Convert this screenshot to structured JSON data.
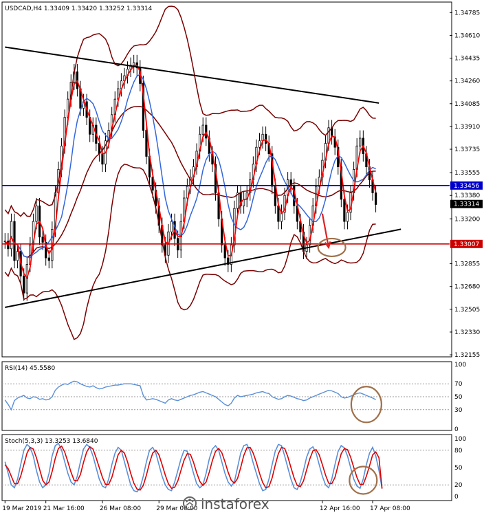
{
  "chart_data": [
    {
      "type": "line",
      "title": "USDCAD,H4  1.33409 1.33420 1.33252 1.33314",
      "symbol": "USDCAD,H4",
      "ohlc": {
        "open": 1.33409,
        "high": 1.3342,
        "low": 1.33252,
        "close": 1.33314
      },
      "ylim": [
        1.3215,
        1.3485
      ],
      "y_ticks": [
        "1.34785",
        "1.34610",
        "1.34435",
        "1.34260",
        "1.34085",
        "1.33910",
        "1.33735",
        "1.33555",
        "1.33380",
        "1.33200",
        "1.32855",
        "1.32680",
        "1.32505",
        "1.32330",
        "1.32155"
      ],
      "x_ticks": [
        "19 Mar 2019",
        "21 Mar 16:00",
        "26 Mar 08:00",
        "29 Mar 00:00",
        "12 Apr 16:00",
        "17 Apr 08:00"
      ],
      "bar_count": 130,
      "horizontal_levels": [
        {
          "value": 1.33456,
          "label": "1.33456",
          "color": "#0000cc"
        },
        {
          "value": 1.33007,
          "label": "1.33007",
          "color": "#cc0000"
        }
      ],
      "current_price": {
        "value": 1.33314,
        "label": "1.33314"
      },
      "price_series": [
        1.3303,
        1.3297,
        1.3318,
        1.3288,
        1.3295,
        1.3276,
        1.3263,
        1.3285,
        1.33,
        1.3318,
        1.333,
        1.3306,
        1.3302,
        1.329,
        1.3288,
        1.3312,
        1.334,
        1.3358,
        1.3376,
        1.3398,
        1.3412,
        1.3425,
        1.3433,
        1.342,
        1.3405,
        1.341,
        1.3398,
        1.3385,
        1.3392,
        1.3378,
        1.337,
        1.3362,
        1.338,
        1.3388,
        1.34,
        1.3412,
        1.342,
        1.3426,
        1.343,
        1.3435,
        1.3438,
        1.344,
        1.3436,
        1.3424,
        1.3388,
        1.3368,
        1.3352,
        1.3342,
        1.333,
        1.3315,
        1.33,
        1.3292,
        1.331,
        1.3318,
        1.3305,
        1.3296,
        1.3318,
        1.3336,
        1.3345,
        1.3352,
        1.336,
        1.3372,
        1.3385,
        1.3392,
        1.3382,
        1.337,
        1.3362,
        1.334,
        1.332,
        1.33,
        1.329,
        1.3285,
        1.33,
        1.3328,
        1.334,
        1.333,
        1.3335,
        1.334,
        1.335,
        1.3362,
        1.3375,
        1.338,
        1.3385,
        1.3378,
        1.337,
        1.3345,
        1.333,
        1.3318,
        1.3325,
        1.3338,
        1.335,
        1.3345,
        1.333,
        1.3318,
        1.331,
        1.3295,
        1.33,
        1.3315,
        1.333,
        1.3345,
        1.3352,
        1.3365,
        1.3378,
        1.339,
        1.3383,
        1.3375,
        1.336,
        1.3335,
        1.3318,
        1.3325,
        1.334,
        1.3358,
        1.3376,
        1.3382,
        1.337,
        1.336,
        1.335,
        1.334,
        1.3331
      ],
      "trend_lines": [
        {
          "name": "upper-trendline",
          "from": {
            "bar": 0,
            "price": 1.3452
          },
          "to": {
            "bar": 119,
            "price": 1.3409
          }
        },
        {
          "name": "lower-trendline",
          "from": {
            "bar": 0,
            "price": 1.3252
          },
          "to": {
            "bar": 126,
            "price": 1.3312
          }
        }
      ],
      "annotations": [
        {
          "type": "arrow",
          "color": "#e02020",
          "from": {
            "bar": 101,
            "price": 1.3324
          },
          "to": {
            "bar": 103,
            "price": 1.3298
          }
        },
        {
          "type": "ellipse",
          "color": "#a0704a",
          "center": {
            "bar": 104,
            "price": 1.3298
          }
        }
      ]
    },
    {
      "type": "line",
      "title": "RSI(14) 45.5580",
      "indicator": "RSI(14)",
      "current_value": 45.558,
      "ylim": [
        0,
        100
      ],
      "y_ticks": [
        "100",
        "70",
        "50",
        "30",
        "0"
      ],
      "levels": [
        70,
        50,
        30
      ],
      "series": [
        {
          "values": [
            45,
            38,
            30,
            44,
            48,
            50,
            52,
            48,
            47,
            50,
            49,
            46,
            47,
            45,
            46,
            50,
            60,
            65,
            68,
            70,
            69,
            72,
            74,
            73,
            70,
            68,
            66,
            65,
            67,
            64,
            62,
            63,
            65,
            66,
            67,
            68,
            68,
            69,
            70,
            70,
            70,
            69,
            68,
            67,
            52,
            45,
            46,
            47,
            46,
            44,
            42,
            40,
            45,
            47,
            45,
            44,
            46,
            48,
            50,
            52,
            53,
            55,
            57,
            58,
            56,
            54,
            52,
            50,
            46,
            42,
            38,
            36,
            40,
            48,
            52,
            50,
            51,
            52,
            53,
            54,
            56,
            57,
            58,
            56,
            55,
            50,
            48,
            46,
            47,
            50,
            52,
            51,
            49,
            47,
            46,
            44,
            45,
            48,
            50,
            52,
            54,
            56,
            58,
            60,
            59,
            57,
            55,
            50,
            48,
            49,
            51,
            53,
            55,
            56,
            54,
            52,
            50,
            48,
            45.558
          ]
        }
      ]
    },
    {
      "type": "line",
      "title": "Stoch(5,3,3) 13.3253 13.6840",
      "indicator": "Stoch(5,3,3)",
      "main_value": 13.3253,
      "signal_value": 13.684,
      "ylim": [
        0,
        100
      ],
      "y_ticks": [
        "100",
        "80",
        "50",
        "20",
        "0"
      ],
      "levels": [
        80,
        20
      ],
      "series": [
        {
          "values": [
            60,
            40,
            20,
            15,
            30,
            55,
            80,
            90,
            85,
            70,
            45,
            25,
            15,
            20,
            40,
            70,
            88,
            92,
            80,
            60,
            40,
            25,
            20,
            35,
            60,
            82,
            90,
            85,
            70,
            50,
            30,
            18,
            15,
            30,
            55,
            75,
            85,
            80,
            60,
            40,
            20,
            10,
            8,
            15,
            35,
            60,
            80,
            85,
            75,
            55,
            35,
            20,
            12,
            10,
            25,
            45,
            65,
            80,
            78,
            60,
            40,
            22,
            15,
            20,
            40,
            65,
            82,
            88,
            80,
            60,
            40,
            25,
            18,
            25,
            50,
            75,
            88,
            90,
            78,
            58,
            40,
            22,
            10,
            12,
            30,
            55,
            78,
            90,
            88,
            70,
            50,
            30,
            15,
            12,
            25,
            45,
            68,
            82,
            86,
            75,
            55,
            35,
            20,
            15,
            30,
            55,
            78,
            88,
            84,
            70,
            50,
            30,
            18,
            14,
            30,
            55,
            75,
            85,
            70,
            45,
            13.3253
          ]
        },
        {
          "values": [
            55,
            48,
            35,
            22,
            22,
            35,
            55,
            75,
            85,
            82,
            67,
            47,
            28,
            20,
            25,
            43,
            66,
            83,
            87,
            77,
            60,
            42,
            28,
            27,
            38,
            59,
            77,
            86,
            82,
            67,
            50,
            33,
            21,
            21,
            33,
            53,
            72,
            80,
            75,
            60,
            40,
            23,
            13,
            11,
            19,
            37,
            58,
            75,
            80,
            72,
            55,
            37,
            22,
            14,
            16,
            27,
            45,
            63,
            74,
            73,
            59,
            41,
            26,
            19,
            25,
            42,
            62,
            78,
            83,
            76,
            60,
            42,
            28,
            23,
            31,
            50,
            71,
            84,
            85,
            75,
            59,
            40,
            24,
            15,
            17,
            32,
            54,
            74,
            85,
            83,
            69,
            50,
            32,
            19,
            17,
            27,
            46,
            65,
            79,
            81,
            72,
            55,
            37,
            23,
            22,
            33,
            54,
            74,
            83,
            81,
            68,
            50,
            33,
            21,
            21,
            35,
            53,
            72,
            77,
            67,
            13.684
          ]
        }
      ]
    }
  ],
  "watermark": "instaforex",
  "colors": {
    "price": "#000000",
    "bollinger": "#7a0000",
    "ma_fast": "#ff0000",
    "ma_slow": "#3366dd",
    "rsi": "#5a8fd8",
    "stoch_main": "#5a8fd8",
    "stoch_signal": "#e00000",
    "circle": "#a0704a",
    "blue_level": "#0000cc",
    "red_level": "#cc0000"
  }
}
